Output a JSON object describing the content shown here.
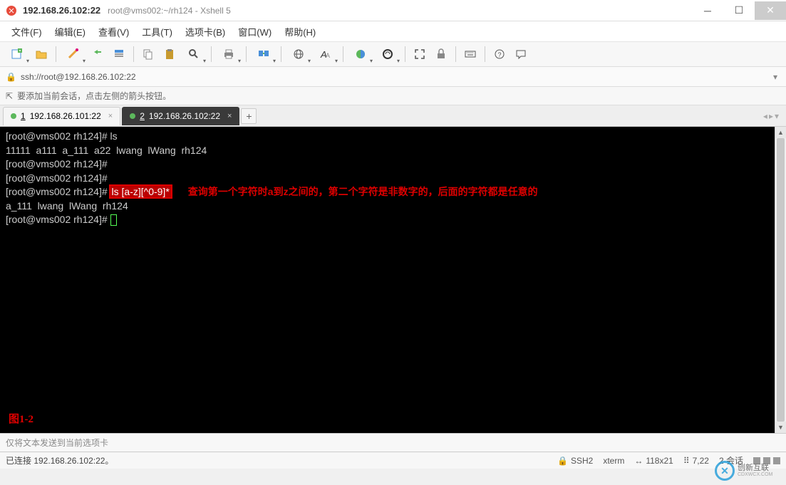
{
  "window": {
    "title": "192.168.26.102:22",
    "subtitle": "root@vms002:~/rh124 - Xshell 5"
  },
  "menu": {
    "file": "文件(F)",
    "edit": "编辑(E)",
    "view": "查看(V)",
    "tools": "工具(T)",
    "tabs": "选项卡(B)",
    "window": "窗口(W)",
    "help": "帮助(H)"
  },
  "address": {
    "url": "ssh://root@192.168.26.102:22"
  },
  "hint": {
    "text": "要添加当前会话，点击左侧的箭头按钮。"
  },
  "tabs": {
    "items": [
      {
        "num": "1",
        "label": "192.168.26.101:22",
        "active": false
      },
      {
        "num": "2",
        "label": "192.168.26.102:22",
        "active": true
      }
    ]
  },
  "terminal": {
    "l1": "[root@vms002 rh124]# ls",
    "l2": "11111  a111  a_111  a22  lwang  lWang  rh124",
    "l3": "[root@vms002 rh124]# ",
    "l4": "[root@vms002 rh124]# ",
    "l5_prompt": "[root@vms002 rh124]# ",
    "l5_cmd": "ls [a-z][^0-9]*",
    "l5_annot": "查询第一个字符时a到z之间的，第二个字符是非数字的，后面的字符都是任意的",
    "l6": "a_111  lwang  lWang  rh124",
    "l7": "[root@vms002 rh124]# ",
    "figlabel": "图1-2"
  },
  "inputbar": {
    "placeholder": "仅将文本发送到当前选项卡"
  },
  "status": {
    "conn": "已连接 192.168.26.102:22。",
    "ssh": "SSH2",
    "term": "xterm",
    "size": "118x21",
    "pos": "7,22",
    "sessions": "2 会话"
  },
  "watermark": {
    "name": "创新互联",
    "sub": "CDXWCX.COM"
  },
  "icons": {
    "new": "new-session-icon",
    "open": "open-icon",
    "script": "script-icon",
    "reconnect": "reconnect-icon",
    "disconnect": "disconnect-icon",
    "properties": "properties-icon",
    "copy": "copy-icon",
    "paste": "paste-icon",
    "find": "find-icon",
    "print": "print-icon",
    "globe": "globe-icon",
    "font": "font-icon",
    "color": "color-scheme-icon",
    "encoding": "encoding-icon",
    "fullscreen": "fullscreen-icon",
    "lock": "lock-icon",
    "keyboard": "keyboard-icon",
    "help": "help-icon",
    "chat": "chat-icon"
  }
}
